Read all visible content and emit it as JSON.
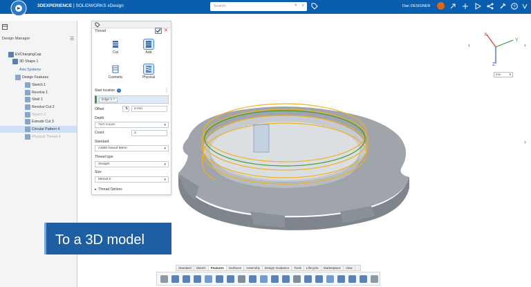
{
  "topbar": {
    "brand_bold": "3DEXPERIENCE",
    "brand_rest": " | SOLIDWORKS xDesign",
    "search_placeholder": "Search",
    "user_name": "Dan DESIGNER"
  },
  "design_manager": {
    "title": "Design Manager",
    "tree": [
      {
        "label": "EVChargingCap",
        "indent": 0
      },
      {
        "label": "3D Shape 1",
        "indent": 1
      },
      {
        "label": "Axis Systems",
        "indent": 1
      },
      {
        "label": "Design Features",
        "indent": 1
      },
      {
        "label": "Sketch 1",
        "indent": 2
      },
      {
        "label": "Revolve 1",
        "indent": 2
      },
      {
        "label": "Shell 1",
        "indent": 2
      },
      {
        "label": "Revolve Cut 2",
        "indent": 2
      },
      {
        "label": "Sketch 2",
        "indent": 2
      },
      {
        "label": "Extrude Cut 3",
        "indent": 2
      },
      {
        "label": "Circular Pattern 4",
        "indent": 2
      },
      {
        "label": "Physical Thread 4",
        "indent": 2
      }
    ]
  },
  "thread_panel": {
    "title": "Thread",
    "options": [
      {
        "label": "Cut"
      },
      {
        "label": "Add"
      },
      {
        "label": "Cosmetic"
      },
      {
        "label": "Physical"
      }
    ],
    "start_location_label": "Start location",
    "start_location_value": "Edge 1",
    "offset_label": "Offset",
    "offset_value": "0 mm",
    "depth_label": "Depth",
    "depth_value": "Turn Count",
    "count_label": "Count",
    "count_value": "3",
    "standard_label": "Standard",
    "standard_value": "ASME-based Metric",
    "thread_type_label": "Thread type",
    "thread_type_value": "Straight",
    "size_label": "Size",
    "size_value": "M64x6.0",
    "thread_options_label": "Thread Options"
  },
  "viewport": {
    "axis_x": "X",
    "axis_y": "Y",
    "axis_z": "Z",
    "view_selector": "mrv"
  },
  "banner": {
    "text": "To a 3D model"
  },
  "toolbar_tabs": [
    "Standard",
    "Sketch",
    "Features",
    "Surfaces",
    "Assembly",
    "Design Guidance",
    "Tools",
    "Lifecycle",
    "Marketplace",
    "View"
  ],
  "colors": {
    "topbar": "#0a5eb0",
    "banner": "#1e5fa3",
    "thread": "#f0b020",
    "edge_highlight": "#3a9a3a",
    "part": "#8a8f96"
  }
}
